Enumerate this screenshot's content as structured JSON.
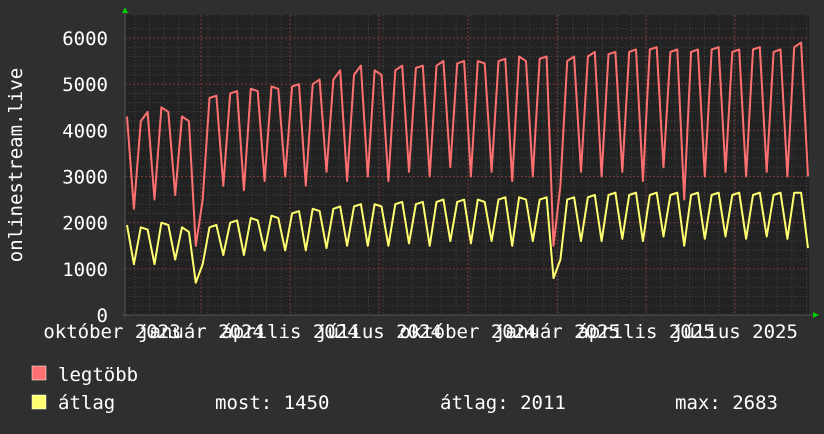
{
  "chart_data": {
    "type": "line",
    "ylabel": "onlinestream.live",
    "ylim": [
      0,
      6000
    ],
    "yticks": [
      "0",
      "1000",
      "2000",
      "3000",
      "4000",
      "5000",
      "6000"
    ],
    "xtick_labels": [
      "október 2023",
      "január 2024",
      "április 2024",
      "július 2024",
      "október 2024",
      "január 2025",
      "április 2025",
      "július 2025"
    ],
    "grid": true,
    "series": [
      {
        "name": "legtöbb",
        "color": "#ff7070",
        "values": [
          4300,
          2300,
          4200,
          4400,
          2500,
          4500,
          4400,
          2600,
          4300,
          4200,
          1500,
          2500,
          4700,
          4750,
          2800,
          4800,
          4850,
          2700,
          4900,
          4850,
          2900,
          4950,
          4900,
          3000,
          4950,
          5000,
          2800,
          5000,
          5100,
          3100,
          5100,
          5300,
          2900,
          5200,
          5400,
          3000,
          5300,
          5200,
          2900,
          5300,
          5400,
          3100,
          5350,
          5400,
          3000,
          5400,
          5500,
          3200,
          5450,
          5500,
          3000,
          5500,
          5450,
          3100,
          5500,
          5550,
          2900,
          5600,
          5500,
          3000,
          5550,
          5600,
          1500,
          2800,
          5500,
          5600,
          3100,
          5600,
          5700,
          3000,
          5650,
          5700,
          3100,
          5700,
          5750,
          2900,
          5750,
          5800,
          3200,
          5700,
          5750,
          2500,
          5700,
          5750,
          3000,
          5750,
          5800,
          3100,
          5700,
          5750,
          3000,
          5750,
          5800,
          3100,
          5700,
          5750,
          3000,
          5800,
          5900,
          3000
        ]
      },
      {
        "name": "átlag",
        "color": "#ffff70",
        "values": [
          1950,
          1100,
          1900,
          1850,
          1100,
          2000,
          1950,
          1200,
          1900,
          1800,
          700,
          1100,
          1900,
          1950,
          1300,
          2000,
          2050,
          1300,
          2100,
          2050,
          1400,
          2150,
          2100,
          1400,
          2200,
          2250,
          1400,
          2300,
          2250,
          1450,
          2300,
          2350,
          1500,
          2350,
          2400,
          1500,
          2400,
          2350,
          1500,
          2400,
          2450,
          1550,
          2400,
          2450,
          1500,
          2450,
          2500,
          1600,
          2450,
          2500,
          1550,
          2500,
          2450,
          1600,
          2500,
          2550,
          1500,
          2550,
          2500,
          1600,
          2500,
          2550,
          800,
          1200,
          2500,
          2550,
          1600,
          2550,
          2600,
          1600,
          2600,
          2650,
          1650,
          2600,
          2650,
          1600,
          2600,
          2650,
          1700,
          2600,
          2650,
          1500,
          2600,
          2650,
          1650,
          2600,
          2650,
          1700,
          2600,
          2650,
          1650,
          2600,
          2650,
          1700,
          2600,
          2650,
          1650,
          2650,
          2650,
          1450
        ]
      }
    ],
    "legend": {
      "placement": "bottom-left",
      "items": [
        "legtöbb",
        "átlag"
      ],
      "stats": {
        "now": "most: 1450",
        "avg": "átlag: 2011",
        "max": "max: 2683"
      }
    }
  }
}
